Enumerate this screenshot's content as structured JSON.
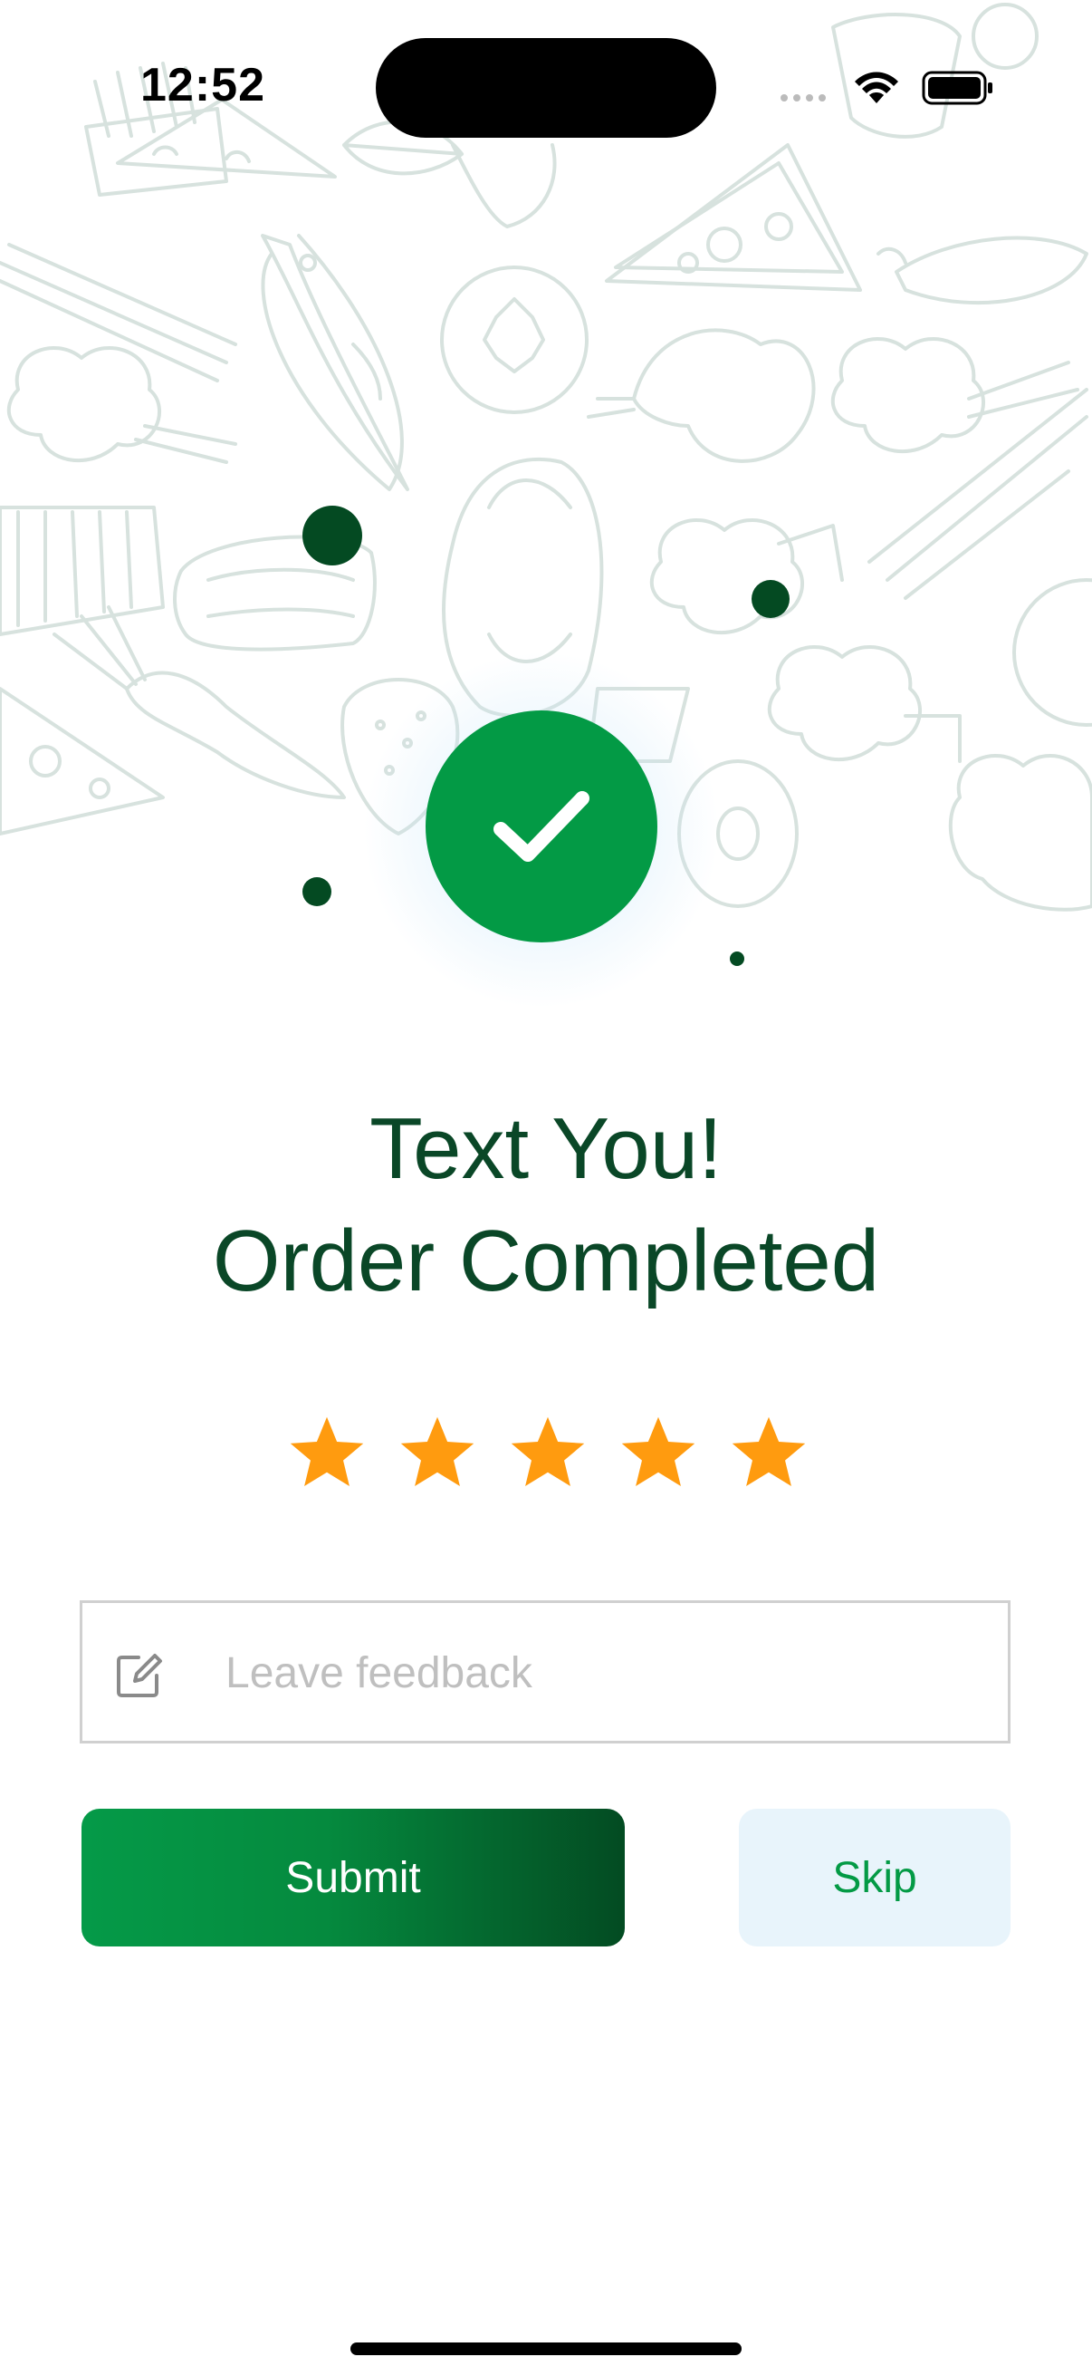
{
  "status_bar": {
    "time": "12:52"
  },
  "success": {
    "title_line1": "Text You!",
    "title_line2": "Order Completed"
  },
  "rating": {
    "value": 5,
    "max": 5,
    "star_color": "#ff9b0f"
  },
  "feedback": {
    "placeholder": "Leave feedback",
    "value": ""
  },
  "actions": {
    "submit_label": "Submit",
    "skip_label": "Skip"
  },
  "colors": {
    "primary_green": "#039a45",
    "dark_green": "#0a4727",
    "skip_bg": "#e8f4fb",
    "doodle": "#d7e2de"
  },
  "icons": {
    "check": "checkmark-icon",
    "feedback": "edit-note-icon",
    "wifi": "wifi-icon",
    "battery": "battery-icon",
    "star": "star-icon"
  }
}
